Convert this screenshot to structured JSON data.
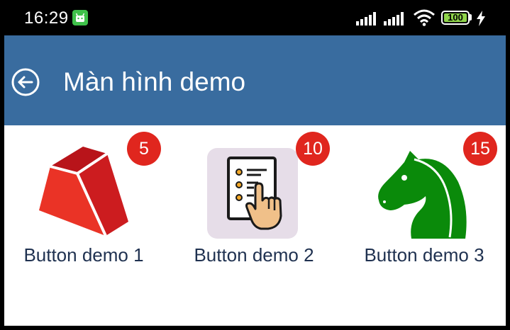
{
  "status_bar": {
    "time": "16:29",
    "battery": "100",
    "icons": [
      "android-notification-icon",
      "signal-icon",
      "signal-icon",
      "wifi-icon",
      "battery-icon",
      "charging-bolt-icon"
    ]
  },
  "app_bar": {
    "title": "Màn hình demo",
    "back_icon": "back-arrow-circle-icon",
    "background": "#396c9f"
  },
  "items": [
    {
      "label": "Button demo 1",
      "badge": "5",
      "icon": "red-3d-block-icon"
    },
    {
      "label": "Button demo 2",
      "badge": "10",
      "icon": "checklist-tap-icon"
    },
    {
      "label": "Button demo 3",
      "badge": "15",
      "icon": "chess-knight-icon"
    }
  ],
  "colors": {
    "badge": "#e0261e",
    "label_text": "#1f3150",
    "knight": "#0a8a0a",
    "block": "#e0261e"
  }
}
